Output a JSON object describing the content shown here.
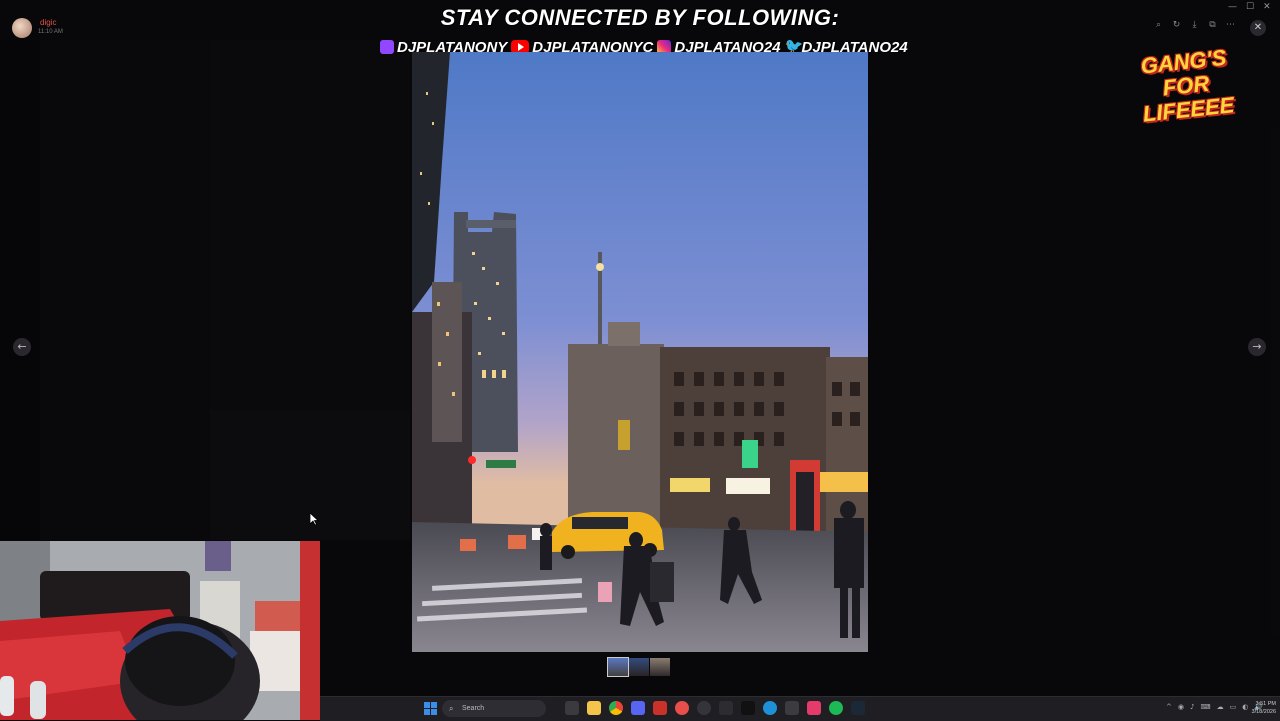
{
  "user": {
    "name": "digic",
    "time": "11:10 AM"
  },
  "banner": {
    "title": "STAY CONNECTED BY FOLLOWING:",
    "socials": [
      {
        "icon": "twitch-icon",
        "handle": "DJPLATANONY"
      },
      {
        "icon": "youtube-icon",
        "handle": "DJPLATANONYC"
      },
      {
        "icon": "instagram-icon",
        "handle": "DJPLATANO24"
      },
      {
        "icon": "twitter-icon",
        "handle": "DJPLATANO24"
      }
    ]
  },
  "logo": {
    "line1": "GANG'S",
    "line2": "FOR",
    "line3": "LIFEEEE"
  },
  "viewer": {
    "prev_glyph": "←",
    "next_glyph": "→",
    "close_glyph": "✕",
    "tools": [
      "⌕",
      "↻",
      "⤓",
      "⧉",
      "⋯"
    ],
    "thumbnails": 3,
    "active_thumbnail": 1
  },
  "window": {
    "minimize": "—",
    "maximize": "☐",
    "close": "✕"
  },
  "taskbar": {
    "search_placeholder": "Search",
    "clock_time": "3:51 PM",
    "clock_date": "3/18/2026",
    "tray": [
      "^",
      "◉",
      "♪",
      "⌨",
      "☁",
      "▭",
      "◐",
      "🔊"
    ]
  },
  "colors": {
    "accent_twitch": "#9146ff",
    "accent_youtube": "#ff0000",
    "logo_yellow": "#ffd53b",
    "logo_red": "#c2261c"
  }
}
